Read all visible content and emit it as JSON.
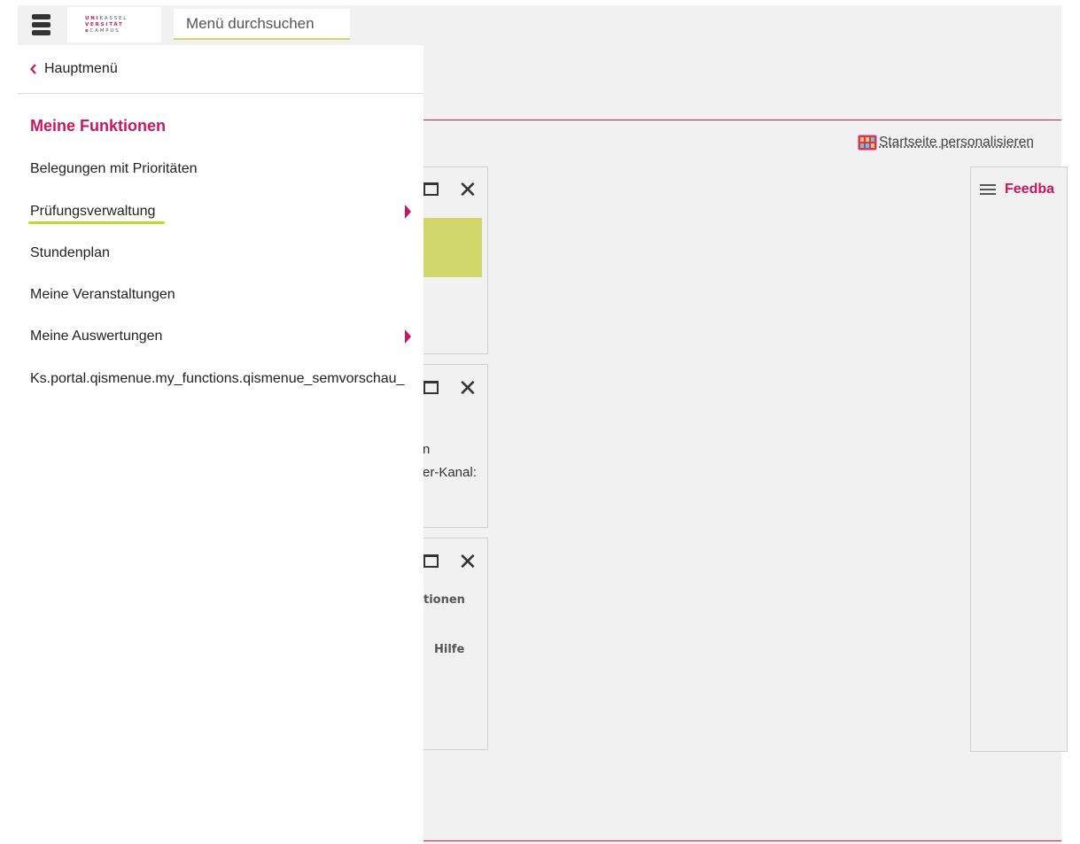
{
  "header": {
    "logo_lines": [
      "UNIKASSEL",
      "VERSITÄT",
      "eCAMPUS"
    ],
    "search_placeholder": "Menü durchsuchen"
  },
  "side_menu": {
    "back_label": "Hauptmenü",
    "section_title": "Meine Funktionen",
    "items": [
      {
        "label": "Belegungen mit Prioritäten",
        "has_submenu": false
      },
      {
        "label": "Prüfungsverwaltung",
        "has_submenu": true,
        "highlighted": true
      },
      {
        "label": "Stundenplan",
        "has_submenu": false
      },
      {
        "label": "Meine Veranstaltungen",
        "has_submenu": false
      },
      {
        "label": "Meine Auswertungen",
        "has_submenu": true
      },
      {
        "label": "Ks.portal.qismenue.my_functions.qismenue_semvorschau_",
        "has_submenu": false
      }
    ]
  },
  "main": {
    "personalize_label": "Startseite personalisieren",
    "widget2_fragments": [
      "n",
      "er-Kanal:"
    ],
    "widget3_fragments": [
      "tionen",
      "Hilfe"
    ],
    "feedback_title": "Feedba"
  },
  "colors": {
    "accent": "#c6175f",
    "highlight_underline": "#b8e021",
    "green_block": "#d1d76a",
    "page_background": "#f1f1f1"
  },
  "icons": {
    "menu_toggle": "hamburger-icon",
    "back": "chevron-left-icon",
    "submenu": "chevron-right-icon",
    "widget_maximize": "maximize-icon",
    "widget_close": "close-icon",
    "personalize": "grid-icon",
    "feedback": "lines-icon"
  }
}
